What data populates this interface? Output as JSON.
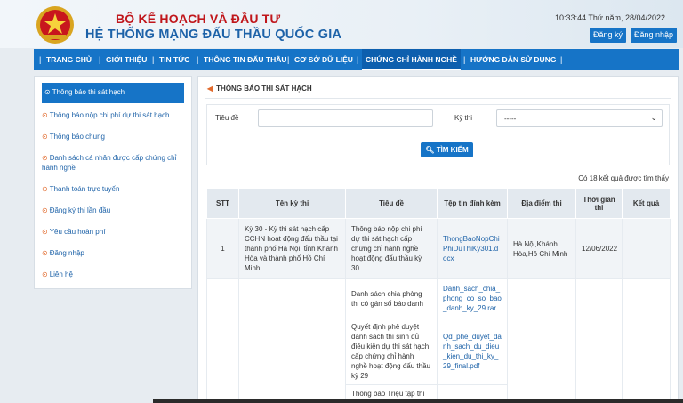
{
  "header": {
    "title_line1": "BỘ KẾ HOẠCH VÀ ĐẦU TƯ",
    "title_line2": "HỆ THỐNG MẠNG ĐẤU THẦU QUỐC GIA",
    "datetime": "10:33:44 Thứ năm, 28/04/2022",
    "register_label": "Đăng ký",
    "login_label": "Đăng nhập"
  },
  "nav": {
    "items": [
      {
        "label": "TRANG CHỦ"
      },
      {
        "label": "GIỚI THIỆU"
      },
      {
        "label": "TIN TỨC"
      },
      {
        "label": "THÔNG TIN ĐẤU THẦU"
      },
      {
        "label": "CƠ SỞ DỮ LIỆU"
      },
      {
        "label": "CHỨNG CHỈ HÀNH NGHỀ"
      },
      {
        "label": "HƯỚNG DẪN SỬ DỤNG"
      }
    ]
  },
  "sidebar": {
    "items": [
      {
        "label": "Thông báo thi sát hạch"
      },
      {
        "label": "Thông báo nộp chi phí dự thi sát hạch"
      },
      {
        "label": "Thông báo chung"
      },
      {
        "label": "Danh sách cá nhân được cấp chứng chỉ hành nghề"
      },
      {
        "label": "Thanh toán trực tuyến"
      },
      {
        "label": "Đăng ký thi lần đầu"
      },
      {
        "label": "Yêu cầu hoàn phí"
      },
      {
        "label": "Đăng nhập"
      },
      {
        "label": "Liên hệ"
      }
    ]
  },
  "main": {
    "section_title": "THÔNG BÁO THI SÁT HẠCH",
    "search": {
      "title_label": "Tiêu đề",
      "title_value": "",
      "exam_label": "Kỳ thi",
      "exam_selected": "-----",
      "button_label": "TÌM KIẾM"
    },
    "result_count": "Có 18 kết quả được tìm thấy",
    "table": {
      "headers": [
        "STT",
        "Tên kỳ thi",
        "Tiêu đề",
        "Tệp tin đính kèm",
        "Địa điểm thi",
        "Thời gian thi",
        "Kết quả"
      ],
      "row1": {
        "stt": "1",
        "exam_name": "Kỳ 30 - Kỳ thi sát hạch cấp CCHN hoạt động đấu thầu tại thành phố Hà Nội, tỉnh Khánh Hòa và thành phố Hồ Chí Minh",
        "location": "Hà Nội,Khánh Hòa,Hồ Chí Minh",
        "date": "12/06/2022",
        "result": ""
      },
      "docs": [
        {
          "title": "Thông báo nộp chi phí dự thi sát hạch cấp chứng chỉ hành nghề hoạt động đấu thầu kỳ 30",
          "file": "ThongBaoNopChiPhiDuThiKy301.docx"
        },
        {
          "title": "Danh sách chia phòng thi có gán số báo danh",
          "file": "Danh_sach_chia_phong_co_so_bao_danh_ky_29.rar"
        },
        {
          "title": "Quyết định phê duyệt danh sách thí sinh đủ điều kiện dự thi sát hạch cấp chứng chỉ hành nghề hoạt động đấu thầu kỳ 29",
          "file": "Qd_phe_duyet_danh_sach_du_dieu_kien_du_thi_ky_29_final.pdf"
        },
        {
          "title": "Thông báo Triệu tập thí sinh đủ điều kiện dự thi",
          "file": ""
        }
      ]
    }
  },
  "colors": {
    "primary_blue": "#1674c7",
    "title_red": "#c0161b",
    "title_blue": "#1d62a8",
    "accent_orange": "#e26a2c"
  }
}
